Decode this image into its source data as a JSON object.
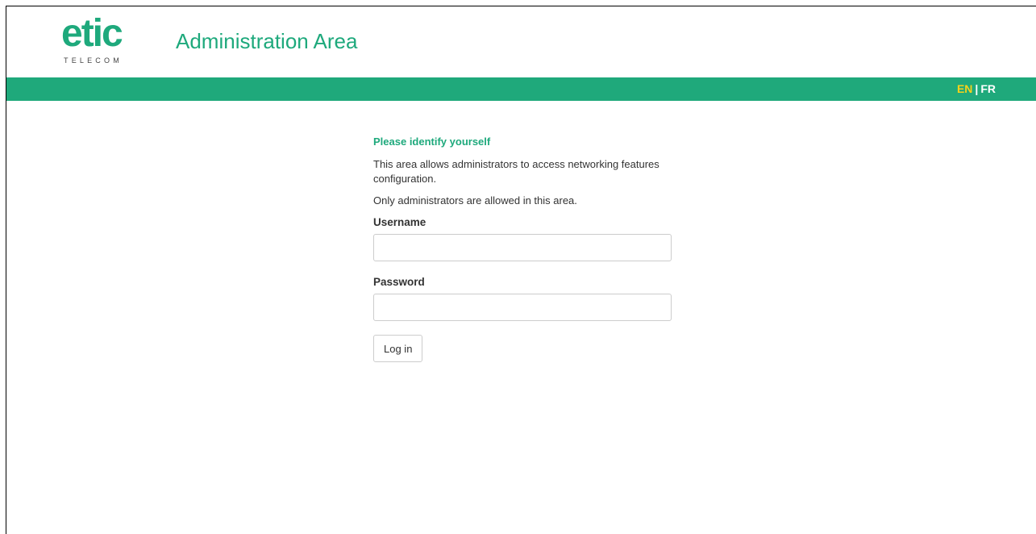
{
  "header": {
    "logo_main": "etic",
    "logo_sub": "TELECOM",
    "title": "Administration Area"
  },
  "language": {
    "active": "EN",
    "separator": "|",
    "other": "FR"
  },
  "login": {
    "heading": "Please identify yourself",
    "description": "This area allows administrators to access networking features configuration.",
    "notice": "Only administrators are allowed in this area.",
    "username_label": "Username",
    "username_value": "",
    "password_label": "Password",
    "password_value": "",
    "submit_label": "Log in"
  },
  "colors": {
    "brand_green": "#1fa97b",
    "active_lang": "#f8d21a"
  }
}
